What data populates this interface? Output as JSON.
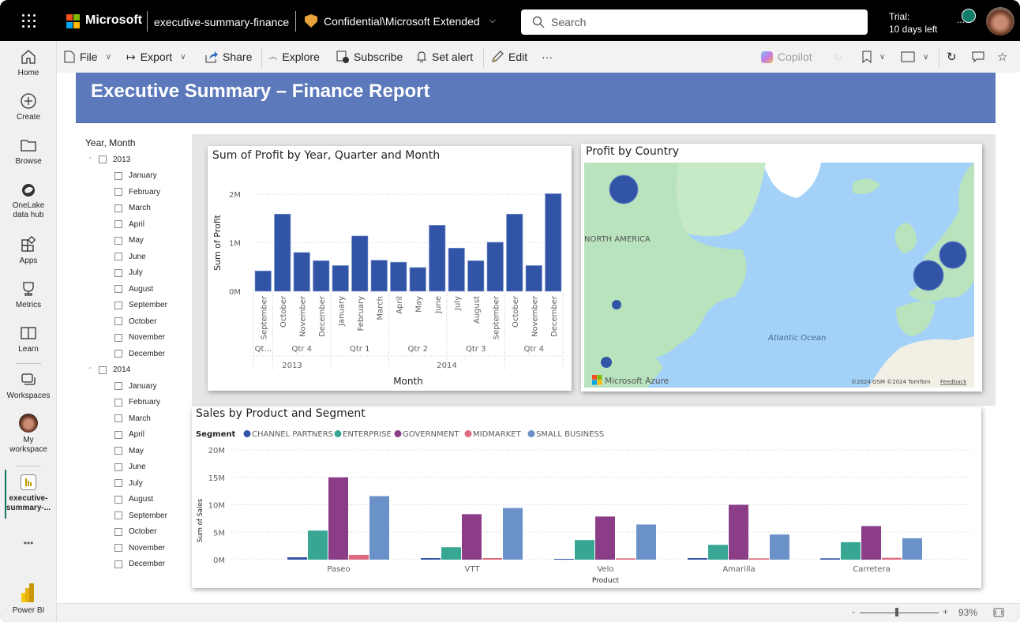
{
  "topbar": {
    "brand": "Microsoft",
    "report_name": "executive-summary-finance",
    "sensitivity": "Confidential\\Microsoft Extended",
    "search_placeholder": "Search",
    "trial_line1": "Trial:",
    "trial_line2": "10 days left",
    "more": "..."
  },
  "rail": {
    "items": [
      {
        "label": "Home",
        "icon": "home-icon"
      },
      {
        "label": "Create",
        "icon": "plus-circle-icon"
      },
      {
        "label": "Browse",
        "icon": "folder-icon"
      },
      {
        "label": "OneLake",
        "label2": "data hub",
        "icon": "onelake-icon"
      },
      {
        "label": "Apps",
        "icon": "apps-icon"
      },
      {
        "label": "Metrics",
        "icon": "trophy-icon"
      },
      {
        "label": "Learn",
        "icon": "book-icon"
      },
      {
        "label": "Workspaces",
        "icon": "workspaces-icon"
      },
      {
        "label": "My",
        "label2": "workspace",
        "icon": "avatar"
      },
      {
        "label": "executive-",
        "label2": "summary-...",
        "icon": "report-icon"
      },
      {
        "label": "•••",
        "icon": "more-icon"
      },
      {
        "label": "Power BI",
        "icon": "powerbi-logo"
      }
    ]
  },
  "toolbar": {
    "file": "File",
    "export": "Export",
    "share": "Share",
    "explore": "Explore",
    "subscribe": "Subscribe",
    "set_alert": "Set alert",
    "edit": "Edit",
    "more": "···",
    "copilot": "Copilot"
  },
  "report": {
    "title": "Executive Summary – Finance Report"
  },
  "slicer": {
    "header": "Year, Month",
    "years": [
      {
        "year": "2013",
        "months": [
          "January",
          "February",
          "March",
          "April",
          "May",
          "June",
          "July",
          "August",
          "September",
          "October",
          "November",
          "December"
        ]
      },
      {
        "year": "2014",
        "months": [
          "January",
          "February",
          "March",
          "April",
          "May",
          "June",
          "July",
          "August",
          "September",
          "October",
          "November",
          "December"
        ]
      }
    ]
  },
  "map": {
    "title": "Profit by Country",
    "labels": {
      "continent": "NORTH AMERICA",
      "ocean": "Atlantic Ocean"
    },
    "attribution": "©2024 OSM  ©2024 TomTom",
    "feedback": "Feedback",
    "provider": "Microsoft Azure",
    "bubbles": [
      {
        "country": "Canada",
        "size": "large"
      },
      {
        "country": "United States of America",
        "size": "small"
      },
      {
        "country": "Mexico",
        "size": "small"
      },
      {
        "country": "France",
        "size": "large"
      },
      {
        "country": "Germany",
        "size": "large"
      }
    ]
  },
  "footer": {
    "zoom_minus": "-",
    "zoom_plus": "+",
    "zoom_level": "93%",
    "zoom_fraction": 0.47
  },
  "chart_data": [
    {
      "type": "bar",
      "title": "Sum of Profit by Year, Quarter and Month",
      "xlabel": "Month",
      "ylabel": "Sum of Profit",
      "ylim": [
        0,
        2000000
      ],
      "yticks": [
        "0M",
        "1M",
        "2M"
      ],
      "ytick_values": [
        0,
        1000000,
        2000000
      ],
      "grid": true,
      "color": "#3154a6",
      "categories": [
        "September",
        "October",
        "November",
        "December",
        "January",
        "February",
        "March",
        "April",
        "May",
        "June",
        "July",
        "August",
        "September",
        "October",
        "November",
        "December"
      ],
      "quarters": [
        {
          "label": "Qt...",
          "span": 1
        },
        {
          "label": "Qtr 4",
          "span": 3
        },
        {
          "label": "Qtr 1",
          "span": 3
        },
        {
          "label": "Qtr 2",
          "span": 3
        },
        {
          "label": "Qtr 3",
          "span": 3
        },
        {
          "label": "Qtr 4",
          "span": 3
        }
      ],
      "years": [
        {
          "label": "2013",
          "span": 4
        },
        {
          "label": "2014",
          "span": 12
        }
      ],
      "values": [
        420000,
        1590000,
        800000,
        630000,
        530000,
        1140000,
        640000,
        600000,
        490000,
        1360000,
        890000,
        630000,
        1010000,
        1590000,
        530000,
        2010000
      ]
    },
    {
      "type": "bar",
      "title": "Sales by Product and Segment",
      "xlabel": "Product",
      "ylabel": "Sum of Sales",
      "legend_title": "Segment",
      "legend_position": "top-left",
      "ylim": [
        0,
        20000000
      ],
      "yticks": [
        "0M",
        "5M",
        "10M",
        "15M",
        "20M"
      ],
      "ytick_values": [
        0,
        5000000,
        10000000,
        15000000,
        20000000
      ],
      "grid": true,
      "categories": [
        "Paseo",
        "VTT",
        "Velo",
        "Amarilla",
        "Carretera"
      ],
      "series": [
        {
          "name": "CHANNEL PARTNERS",
          "color": "#3154a6",
          "values": [
            430000,
            290000,
            140000,
            290000,
            240000
          ]
        },
        {
          "name": "ENTERPRISE",
          "color": "#37a794",
          "values": [
            5300000,
            2270000,
            3570000,
            2700000,
            3180000
          ]
        },
        {
          "name": "GOVERNMENT",
          "color": "#8b3d88",
          "values": [
            15000000,
            8290000,
            7860000,
            10000000,
            6120000
          ]
        },
        {
          "name": "MIDMARKET",
          "color": "#dd6b7f",
          "values": [
            870000,
            290000,
            240000,
            240000,
            340000
          ]
        },
        {
          "name": "SMALL BUSINESS",
          "color": "#6b91c9",
          "values": [
            11580000,
            9410000,
            6410000,
            4580000,
            3900000
          ]
        }
      ]
    }
  ]
}
